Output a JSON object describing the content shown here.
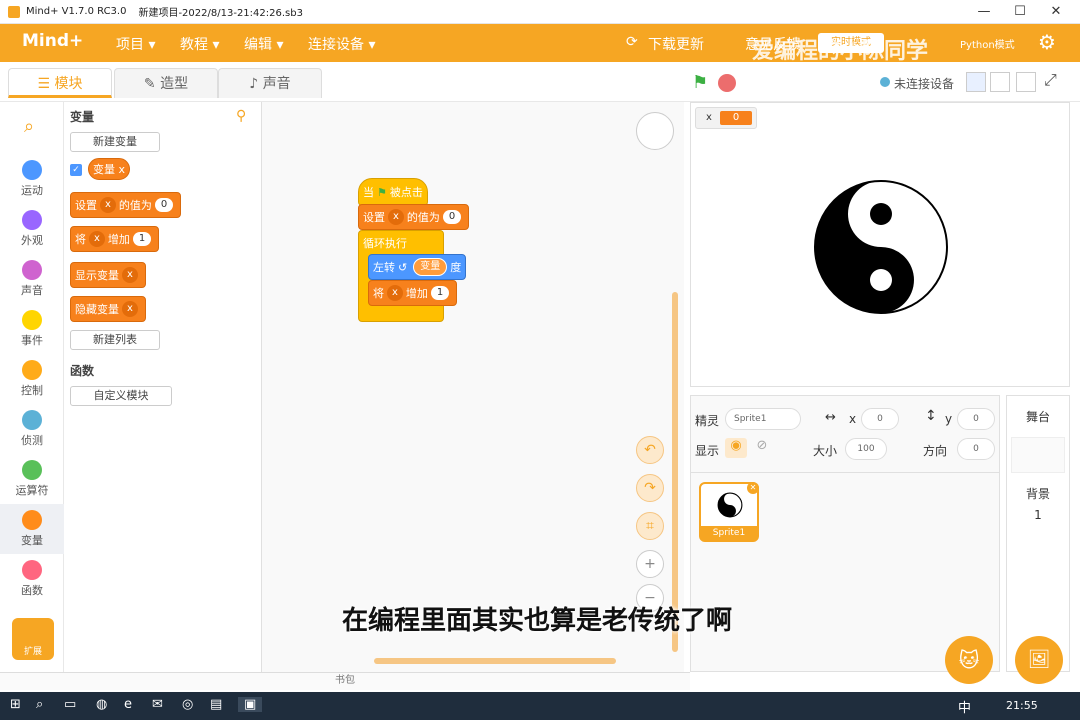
{
  "titlebar": {
    "app": "Mind+ V1.7.0 RC3.0",
    "project": "新建项目-2022/8/13-21:42:26.sb3",
    "min": "—",
    "max": "☐",
    "close": "✕"
  },
  "menubar": {
    "logo": "Mind+",
    "items": [
      "项目 ▾",
      "教程 ▾",
      "编辑 ▾",
      "连接设备 ▾"
    ],
    "download": "下载更新",
    "feedback": "意见反馈",
    "mode_badge": "实时模式",
    "python_mode": "Python模式"
  },
  "tabs": {
    "blocks": "模块",
    "costumes": "造型",
    "sounds": "声音"
  },
  "status": {
    "device": "未连接设备"
  },
  "categories": [
    "运动",
    "外观",
    "声音",
    "事件",
    "控制",
    "侦测",
    "运算符",
    "变量",
    "函数"
  ],
  "category_colors": [
    "#4c97ff",
    "#9966ff",
    "#cf63cf",
    "#ffd500",
    "#ffab19",
    "#5cb1d6",
    "#59c059",
    "#ff8c1a",
    "#ff6680"
  ],
  "extensions": "扩展",
  "palette": {
    "section_var": "变量",
    "new_var": "新建变量",
    "var_name": "变量",
    "var_x": "x",
    "set": "设置",
    "to_value": "的值为",
    "zero": "0",
    "change": "将",
    "by": "增加",
    "one": "1",
    "show_var": "显示变量",
    "hide_var": "隐藏变量",
    "new_list": "新建列表",
    "section_func": "函数",
    "custom_block": "自定义模块"
  },
  "script": {
    "when_flag": "当",
    "clicked": "被点击",
    "set": "设置",
    "x": "x",
    "to_value": "的值为",
    "zero": "0",
    "forever": "循环执行",
    "turn_left": "左转",
    "var": "变量",
    "degree": "度",
    "change": "将",
    "by": "增加",
    "one": "1"
  },
  "monitor": {
    "label": "x",
    "value": "0"
  },
  "sprite_panel": {
    "sprite_label": "精灵",
    "sprite_name": "Sprite1",
    "x_label": "x",
    "x_val": "0",
    "y_label": "y",
    "y_val": "0",
    "show_label": "显示",
    "size_label": "大小",
    "size_val": "100",
    "dir_label": "方向",
    "dir_val": "0",
    "thumb_name": "Sprite1"
  },
  "stage_panel": {
    "title": "舞台",
    "backdrop": "背景",
    "backdrop_count": "1"
  },
  "bottom": {
    "backpack": "书包"
  },
  "subtitle": "在编程里面其实也算是老传统了啊",
  "watermark": "爱编程的小陈同学",
  "taskbar": {
    "ime": "中",
    "time": "21:55"
  }
}
